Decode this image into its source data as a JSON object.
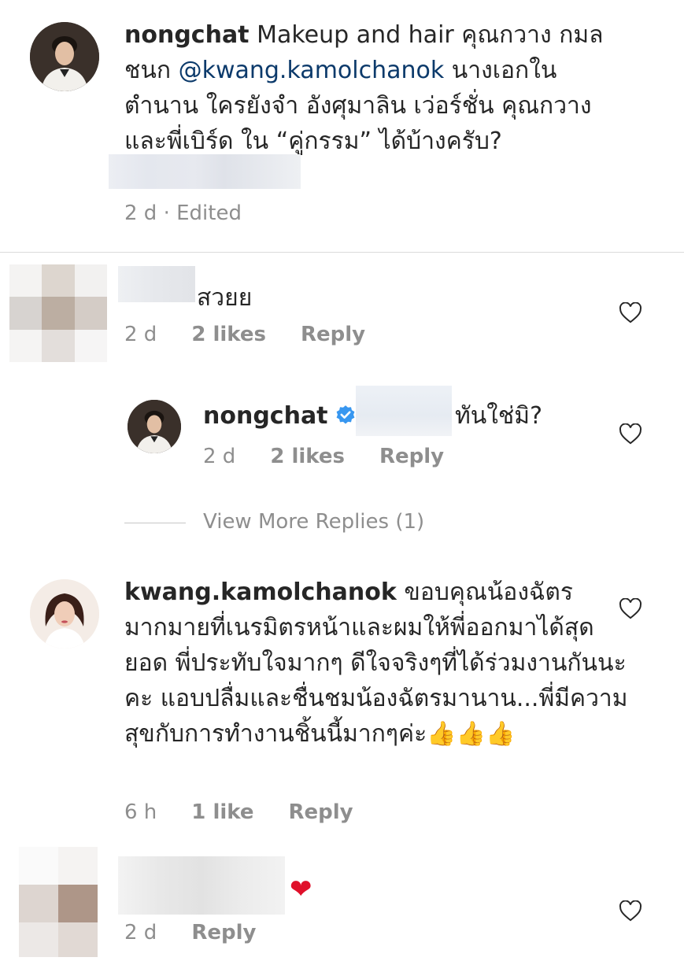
{
  "caption": {
    "username": "nongchat",
    "text_1": " Makeup and hair คุณกวาง กมลชนก ",
    "mention": "@kwang.kamolchanok",
    "text_2": " นางเอกในตำนาน ใครยังจำ อังศุมาลิน เว่อร์ชั่น คุณกวาง และพี่เบิร์ด ใน “คู่กรรม” ได้บ้างครับ?",
    "meta": "2 d · Edited"
  },
  "comment_1": {
    "text": "สวยย",
    "time": "2 d",
    "likes": "2 likes",
    "reply": "Reply"
  },
  "reply_1": {
    "username": "nongchat",
    "text": "ทันใช่มิ?",
    "time": "2 d",
    "likes": "2 likes",
    "reply": "Reply"
  },
  "view_more": "View More Replies (1)",
  "comment_2": {
    "username": "kwang.kamolchanok",
    "text": " ขอบคุณน้องฉัตรมากมายที่เนรมิตรหน้าและผมให้พี่ออกมาได้สุดยอด พี่ประทับใจมากๆ ดีใจจริงๆที่ได้ร่วมงานกันนะคะ  แอบปลื่มและชื่นชมน้องฉัตรมานาน...พี่มีความสุขกับการทำงานชิ้นนี้มากๆค่ะ",
    "emoji": "👍👍👍",
    "time": "6 h",
    "likes": "1 like",
    "reply": "Reply"
  },
  "comment_3": {
    "emoji": "❤",
    "time": "2 d",
    "reply": "Reply"
  },
  "colors": {
    "text": "#262626",
    "muted": "#8e8e8e",
    "mention": "#0c3a6b",
    "verified": "#3897f0",
    "heart": "#e0102a"
  }
}
